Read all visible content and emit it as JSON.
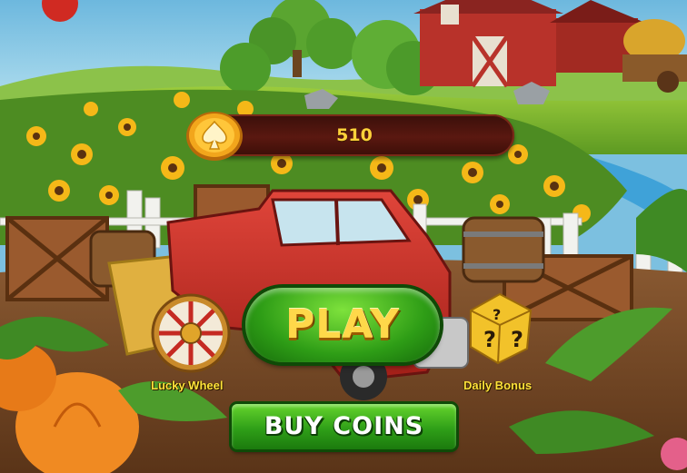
{
  "hud": {
    "coin_balance": "510",
    "coin_icon": "spade-coin-icon"
  },
  "menu": {
    "play_label": "PLAY",
    "buy_coins_label": "BUY COINS"
  },
  "features": {
    "lucky_wheel_label": "Lucky Wheel",
    "daily_bonus_label": "Daily Bonus"
  },
  "colors": {
    "accent_gold": "#ffd84a",
    "button_green": "#2e9d16",
    "bar_brown": "#5a1810"
  }
}
